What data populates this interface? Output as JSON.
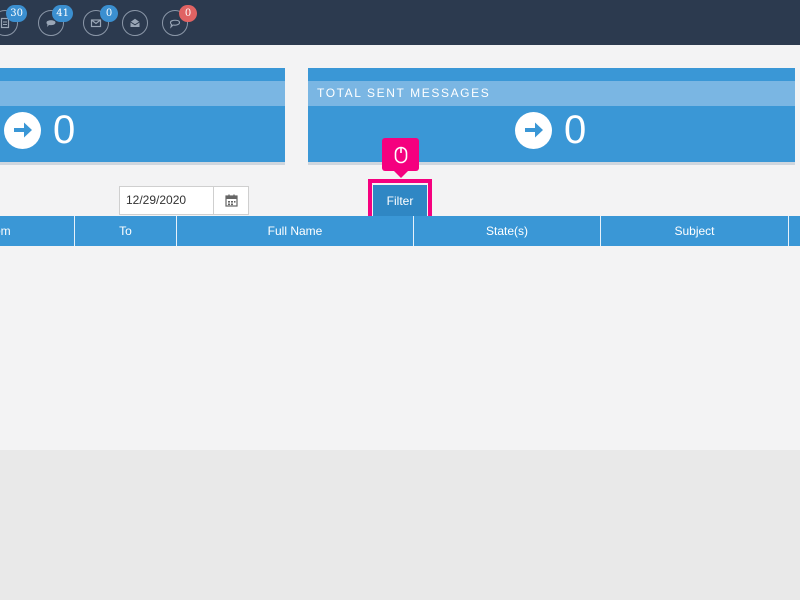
{
  "topbar": {
    "icons": [
      {
        "icon": "document-icon",
        "badge": "30",
        "badge_color": "#3b8fd0"
      },
      {
        "icon": "chat-icon",
        "badge": "41",
        "badge_color": "#3b8fd0"
      },
      {
        "icon": "mail-icon",
        "badge": "0",
        "badge_color": "#3b8fd0"
      },
      {
        "icon": "open-mail-icon",
        "badge": "",
        "badge_color": ""
      },
      {
        "icon": "comment-icon",
        "badge": "0",
        "badge_color": "#e06363"
      }
    ]
  },
  "cards": [
    {
      "title": "",
      "value": "0"
    },
    {
      "title": "TOTAL SENT MESSAGES",
      "value": "0"
    }
  ],
  "filter": {
    "date_value": "12/29/2020",
    "button_label": "Filter"
  },
  "table": {
    "headers": [
      "om",
      "To",
      "Full Name",
      "State(s)",
      "Subject"
    ]
  },
  "colors": {
    "topbar": "#2c3a4f",
    "accent": "#3a97d6",
    "highlight": "#f5007f"
  }
}
